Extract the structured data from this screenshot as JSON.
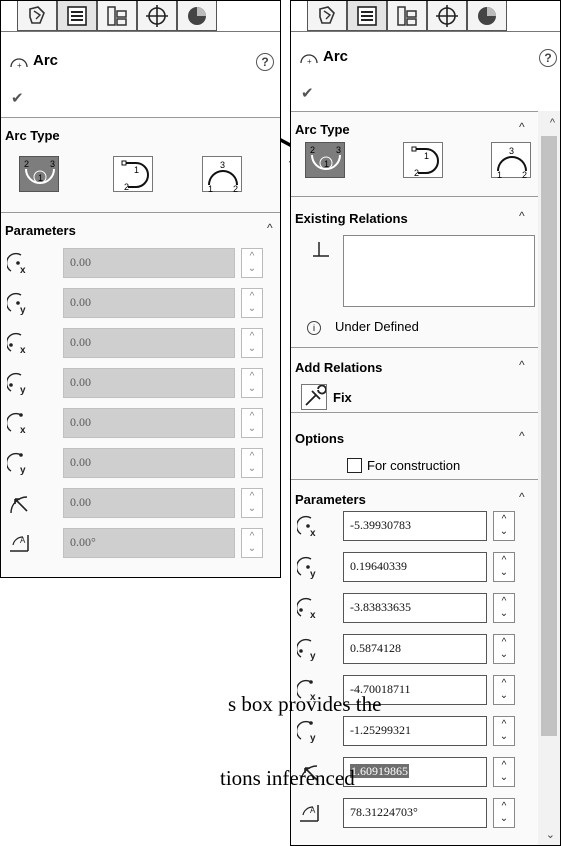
{
  "tabs": [
    "feature-manager-icon",
    "property-manager-icon",
    "configuration-manager-icon",
    "dimxpert-icon",
    "display-manager-icon"
  ],
  "property_manager": {
    "title": "Arc",
    "help": "?",
    "ok": "✔"
  },
  "left_panel": {
    "arc_type": {
      "title": "Arc Type",
      "options": [
        "centerpoint-arc",
        "tangent-arc",
        "3-point-arc"
      ],
      "selected": 0,
      "labels": {
        "a": [
          "1",
          "2",
          "3"
        ],
        "b": [
          "1",
          "2"
        ],
        "c": [
          "1",
          "2",
          "3"
        ]
      }
    },
    "parameters": {
      "title": "Parameters",
      "rows": [
        {
          "icon": "center-x-icon",
          "value": "0.00"
        },
        {
          "icon": "center-y-icon",
          "value": "0.00"
        },
        {
          "icon": "start-x-icon",
          "value": "0.00"
        },
        {
          "icon": "start-y-icon",
          "value": "0.00"
        },
        {
          "icon": "end-x-icon",
          "value": "0.00"
        },
        {
          "icon": "end-y-icon",
          "value": "0.00"
        },
        {
          "icon": "radius-icon",
          "value": "0.00"
        },
        {
          "icon": "angle-icon",
          "value": "0.00°"
        }
      ]
    }
  },
  "right_panel": {
    "arc_type": {
      "title": "Arc Type"
    },
    "existing_relations": {
      "title": "Existing Relations",
      "status": "Under Defined"
    },
    "add_relations": {
      "title": "Add Relations",
      "fix_label": "Fix"
    },
    "options": {
      "title": "Options",
      "for_construction": "For construction",
      "checked": false
    },
    "parameters": {
      "title": "Parameters",
      "rows": [
        {
          "icon": "center-x-icon",
          "value": "-5.39930783"
        },
        {
          "icon": "center-y-icon",
          "value": "0.19640339"
        },
        {
          "icon": "start-x-icon",
          "value": "-3.83833635"
        },
        {
          "icon": "start-y-icon",
          "value": "0.5874128"
        },
        {
          "icon": "end-x-icon",
          "value": "-4.70018711"
        },
        {
          "icon": "end-y-icon",
          "value": "-1.25299321"
        },
        {
          "icon": "radius-icon",
          "value": "1.60919865",
          "highlighted": true
        },
        {
          "icon": "angle-icon",
          "value": "78.31224703°"
        }
      ]
    }
  },
  "body_text": {
    "line1": "s box provides the",
    "line2": "tions inferenced"
  }
}
